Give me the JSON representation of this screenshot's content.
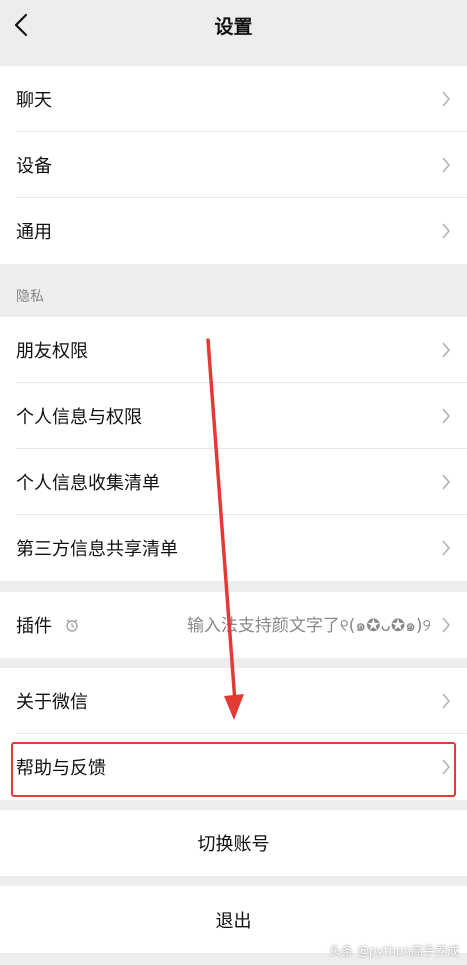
{
  "header": {
    "title": "设置"
  },
  "group1": [
    {
      "label": "聊天"
    },
    {
      "label": "设备"
    },
    {
      "label": "通用"
    }
  ],
  "privacy": {
    "title": "隐私",
    "items": [
      {
        "label": "朋友权限"
      },
      {
        "label": "个人信息与权限"
      },
      {
        "label": "个人信息收集清单"
      },
      {
        "label": "第三方信息共享清单"
      }
    ]
  },
  "plugins": {
    "label": "插件",
    "value": "输入法支持颜文字了୧(๑✪ᴗ✪๑)୨"
  },
  "group4": [
    {
      "label": "关于微信"
    },
    {
      "label": "帮助与反馈"
    }
  ],
  "switch_account": "切换账号",
  "logout": "退出",
  "watermark": "头条 @python高手养成",
  "colors": {
    "background": "#ededed",
    "annotation": "#e53935"
  }
}
